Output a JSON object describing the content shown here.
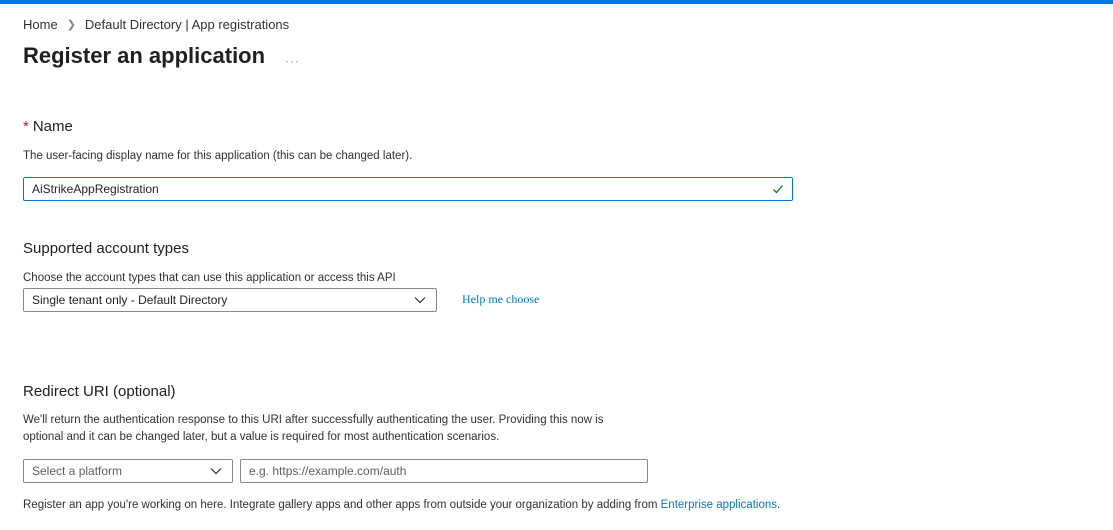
{
  "colors": {
    "accent": "#0078d4",
    "required": "#c50f1f",
    "success": "#107c10"
  },
  "breadcrumb": {
    "home": "Home",
    "current": "Default Directory | App registrations"
  },
  "page": {
    "title": "Register an application",
    "more": "···"
  },
  "name_section": {
    "required_marker": "*",
    "heading": "Name",
    "description": "The user-facing display name for this application (this can be changed later).",
    "value": "AiStrikeAppRegistration",
    "valid_icon": "checkmark-icon"
  },
  "account_section": {
    "heading": "Supported account types",
    "description": "Choose the account types that can use this application or access this API",
    "selected": "Single tenant only - Default Directory",
    "help_link": "Help me choose"
  },
  "redirect_section": {
    "heading": "Redirect URI (optional)",
    "description_line1": "We'll return the authentication response to this URI after successfully authenticating the user. Providing this now is",
    "description_line2": "optional and it can be changed later, but a value is required for most authentication scenarios.",
    "platform_placeholder": "Select a platform",
    "uri_placeholder": "e.g. https://example.com/auth"
  },
  "footer": {
    "text": "Register an app you're working on here. Integrate gallery apps and other apps from outside your organization by adding from",
    "link": "Enterprise applications",
    "end": "."
  }
}
